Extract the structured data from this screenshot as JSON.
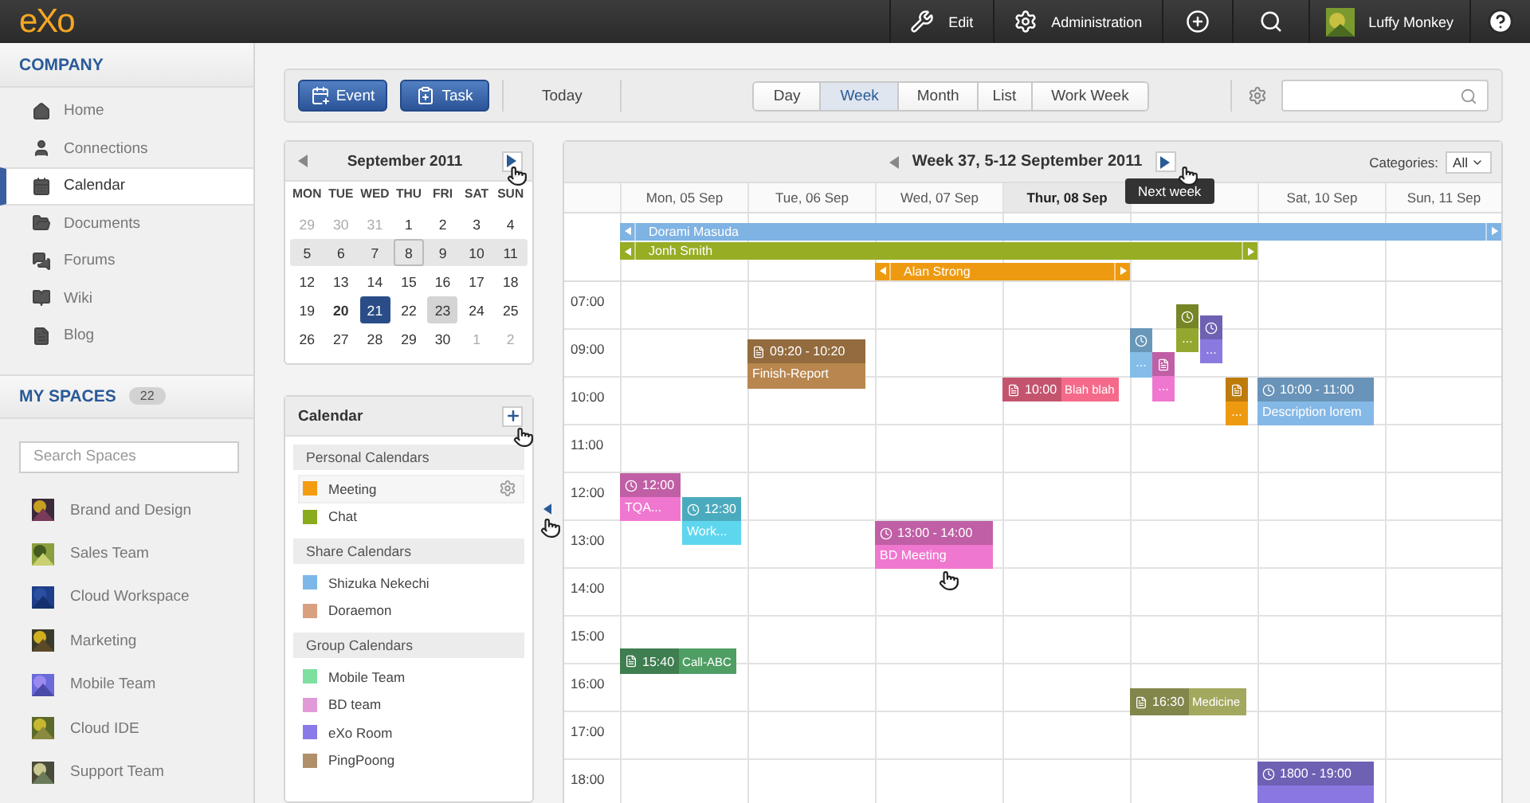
{
  "top_bar": {
    "logo": "eXo",
    "items": [
      {
        "kind": "edit",
        "label": "Edit"
      },
      {
        "kind": "admin",
        "label": "Administration"
      },
      {
        "kind": "add"
      },
      {
        "kind": "search"
      },
      {
        "kind": "user",
        "label": "Luffy Monkey"
      },
      {
        "kind": "help"
      }
    ]
  },
  "sidebar": {
    "company": {
      "title": "COMPANY",
      "items": [
        {
          "label": "Home",
          "selected": false
        },
        {
          "label": "Connections",
          "selected": false
        },
        {
          "label": "Calendar",
          "selected": true
        },
        {
          "label": "Documents",
          "selected": false
        },
        {
          "label": "Forums",
          "selected": false
        },
        {
          "label": "Wiki",
          "selected": false
        },
        {
          "label": "Blog",
          "selected": false
        }
      ]
    },
    "spaces": {
      "title": "MY SPACES",
      "count": "22",
      "search": {
        "placeholder": "Search Spaces"
      },
      "items": [
        {
          "label": "Brand and Design"
        },
        {
          "label": "Sales Team"
        },
        {
          "label": "Cloud Workspace"
        },
        {
          "label": "Marketing"
        },
        {
          "label": "Mobile Team"
        },
        {
          "label": "Cloud IDE"
        },
        {
          "label": "Support Team"
        }
      ]
    }
  },
  "toolbar": {
    "buttons": [
      {
        "kind": "event",
        "label": "Event"
      },
      {
        "kind": "task",
        "label": "Task"
      }
    ],
    "today": "Today",
    "views": [
      {
        "label": "Day",
        "selected": false
      },
      {
        "label": "Week",
        "selected": true
      },
      {
        "label": "Month",
        "selected": false
      },
      {
        "label": "List",
        "selected": false
      },
      {
        "label": "Work Week",
        "selected": false
      }
    ]
  },
  "mini_calendar": {
    "title": "September 2011",
    "weekdays": [
      "MON",
      "TUE",
      "WED",
      "THU",
      "FRI",
      "SAT",
      "SUN"
    ],
    "weeks": [
      {
        "highlighted": false,
        "days": [
          {
            "label": "29",
            "muted": true,
            "selected": false,
            "today": false,
            "outlined": false,
            "shaded": false
          },
          {
            "label": "30",
            "muted": true,
            "selected": false,
            "today": false,
            "outlined": false,
            "shaded": false
          },
          {
            "label": "31",
            "muted": true,
            "selected": false,
            "today": false,
            "outlined": false,
            "shaded": false
          },
          {
            "label": "1",
            "muted": false,
            "selected": false,
            "today": false,
            "outlined": false,
            "shaded": false
          },
          {
            "label": "2",
            "muted": false,
            "selected": false,
            "today": false,
            "outlined": false,
            "shaded": false
          },
          {
            "label": "3",
            "muted": false,
            "selected": false,
            "today": false,
            "outlined": false,
            "shaded": false
          },
          {
            "label": "4",
            "muted": false,
            "selected": false,
            "today": false,
            "outlined": false,
            "shaded": false
          }
        ]
      },
      {
        "highlighted": true,
        "days": [
          {
            "label": "5",
            "muted": false,
            "selected": false,
            "today": false,
            "outlined": false,
            "shaded": false
          },
          {
            "label": "6",
            "muted": false,
            "selected": false,
            "today": false,
            "outlined": false,
            "shaded": false
          },
          {
            "label": "7",
            "muted": false,
            "selected": false,
            "today": false,
            "outlined": false,
            "shaded": false
          },
          {
            "label": "8",
            "muted": false,
            "selected": false,
            "today": false,
            "outlined": true,
            "shaded": false
          },
          {
            "label": "9",
            "muted": false,
            "selected": false,
            "today": false,
            "outlined": false,
            "shaded": false
          },
          {
            "label": "10",
            "muted": false,
            "selected": false,
            "today": false,
            "outlined": false,
            "shaded": false
          },
          {
            "label": "11",
            "muted": false,
            "selected": false,
            "today": false,
            "outlined": false,
            "shaded": false
          }
        ]
      },
      {
        "highlighted": false,
        "days": [
          {
            "label": "12",
            "muted": false,
            "selected": false,
            "today": false,
            "outlined": false,
            "shaded": false
          },
          {
            "label": "13",
            "muted": false,
            "selected": false,
            "today": false,
            "outlined": false,
            "shaded": false
          },
          {
            "label": "14",
            "muted": false,
            "selected": false,
            "today": false,
            "outlined": false,
            "shaded": false
          },
          {
            "label": "15",
            "muted": false,
            "selected": false,
            "today": false,
            "outlined": false,
            "shaded": false
          },
          {
            "label": "16",
            "muted": false,
            "selected": false,
            "today": false,
            "outlined": false,
            "shaded": false
          },
          {
            "label": "17",
            "muted": false,
            "selected": false,
            "today": false,
            "outlined": false,
            "shaded": false
          },
          {
            "label": "18",
            "muted": false,
            "selected": false,
            "today": false,
            "outlined": false,
            "shaded": false
          }
        ]
      },
      {
        "highlighted": false,
        "days": [
          {
            "label": "19",
            "muted": false,
            "selected": false,
            "today": false,
            "outlined": false,
            "shaded": false
          },
          {
            "label": "20",
            "muted": false,
            "selected": false,
            "today": true,
            "outlined": false,
            "shaded": false
          },
          {
            "label": "21",
            "muted": false,
            "selected": true,
            "today": false,
            "outlined": false,
            "shaded": false
          },
          {
            "label": "22",
            "muted": false,
            "selected": false,
            "today": false,
            "outlined": false,
            "shaded": false
          },
          {
            "label": "23",
            "muted": false,
            "selected": false,
            "today": false,
            "outlined": false,
            "shaded": true
          },
          {
            "label": "24",
            "muted": false,
            "selected": false,
            "today": false,
            "outlined": false,
            "shaded": false
          },
          {
            "label": "25",
            "muted": false,
            "selected": false,
            "today": false,
            "outlined": false,
            "shaded": false
          }
        ]
      },
      {
        "highlighted": false,
        "days": [
          {
            "label": "26",
            "muted": false,
            "selected": false,
            "today": false,
            "outlined": false,
            "shaded": false
          },
          {
            "label": "27",
            "muted": false,
            "selected": false,
            "today": false,
            "outlined": false,
            "shaded": false
          },
          {
            "label": "28",
            "muted": false,
            "selected": false,
            "today": false,
            "outlined": false,
            "shaded": false
          },
          {
            "label": "29",
            "muted": false,
            "selected": false,
            "today": false,
            "outlined": false,
            "shaded": false
          },
          {
            "label": "30",
            "muted": false,
            "selected": false,
            "today": false,
            "outlined": false,
            "shaded": false
          },
          {
            "label": "1",
            "muted": true,
            "selected": false,
            "today": false,
            "outlined": false,
            "shaded": false
          },
          {
            "label": "2",
            "muted": true,
            "selected": false,
            "today": false,
            "outlined": false,
            "shaded": false
          }
        ]
      }
    ]
  },
  "calendars": {
    "title": "Calendar",
    "groups": [
      {
        "title": "Personal Calendars",
        "items": [
          {
            "label": "Meeting",
            "color": "#f39c12",
            "selected": true
          },
          {
            "label": "Chat",
            "color": "#8aab1e",
            "selected": false
          }
        ]
      },
      {
        "title": "Share Calendars",
        "items": [
          {
            "label": "Shizuka Nekechi",
            "color": "#7db7e8",
            "selected": false
          },
          {
            "label": "Doraemon",
            "color": "#d8a080",
            "selected": false
          }
        ]
      },
      {
        "title": "Group Calendars",
        "items": [
          {
            "label": "Mobile Team",
            "color": "#7ee0a0",
            "selected": false
          },
          {
            "label": "BD team",
            "color": "#e09ad8",
            "selected": false
          },
          {
            "label": "eXo Room",
            "color": "#8a7ae8",
            "selected": false
          },
          {
            "label": "PingPoong",
            "color": "#b0906a",
            "selected": false
          }
        ]
      }
    ]
  },
  "week_view": {
    "title": "Week 37, 5-12 September 2011",
    "categories_label": "Categories:",
    "category": "All",
    "tooltip": "Next week",
    "all_day": [
      {
        "title": "Dorami Masuda",
        "color": "#7fb3e3",
        "continues_before": true,
        "continues_after": true
      },
      {
        "title": "Jonh Smith",
        "color": "#96ad24",
        "continues_before": true,
        "continues_after": true
      },
      {
        "title": "Alan Strong",
        "color": "#ee9a10",
        "continues_before": true,
        "continues_after": true
      }
    ],
    "hours": [
      "07:00",
      "09:00",
      "10:00",
      "11:00",
      "12:00",
      "13:00",
      "14:00",
      "15:00",
      "16:00",
      "17:00",
      "18:00"
    ],
    "days": [
      {
        "label": "Mon, 05 Sep",
        "selected": false,
        "events": [
          {
            "kind": "event",
            "time": "12:00",
            "title": "TQA...",
            "color": "#f077cf"
          },
          {
            "kind": "event",
            "time": "12:30",
            "title": "Work...",
            "color": "#5ed6ee"
          },
          {
            "kind": "task",
            "time": "15:40",
            "title": "Call-ABC",
            "color": "#4f9e64"
          }
        ]
      },
      {
        "label": "Tue, 06 Sep",
        "selected": false,
        "events": [
          {
            "kind": "task",
            "time": "09:20 - 10:20",
            "title": "Finish-Report",
            "color": "#b8864e"
          }
        ]
      },
      {
        "label": "Wed, 07 Sep",
        "selected": false,
        "events": [
          {
            "kind": "event",
            "time": "13:00 - 14:00",
            "title": "BD Meeting",
            "color": "#f077cf"
          }
        ]
      },
      {
        "label": "Thur, 08 Sep",
        "selected": true,
        "events": [
          {
            "kind": "task",
            "time": "10:00",
            "title": "Blah blah",
            "color": "#f56a8a"
          }
        ]
      },
      {
        "selected": false,
        "events": [
          {
            "kind": "event",
            "title": "...",
            "color": "#94a830"
          },
          {
            "kind": "event",
            "title": "...",
            "color": "#8a7ae0"
          },
          {
            "kind": "event",
            "title": "...",
            "color": "#84bde8"
          },
          {
            "kind": "task",
            "title": "...",
            "color": "#f077cf"
          },
          {
            "kind": "task",
            "title": "...",
            "color": "#ee9a10"
          },
          {
            "kind": "task",
            "time": "16:30",
            "title": "Medicine",
            "color": "#a4a85e"
          }
        ]
      },
      {
        "label": "Sat, 10 Sep",
        "selected": false,
        "events": [
          {
            "kind": "event",
            "time": "10:00 - 11:00",
            "title": "Description lorem",
            "color": "#84b8e6"
          },
          {
            "kind": "event",
            "time": "1800 - 19:00",
            "color": "#8a78e0"
          }
        ]
      },
      {
        "label": "Sun, 11 Sep",
        "selected": false
      }
    ]
  }
}
